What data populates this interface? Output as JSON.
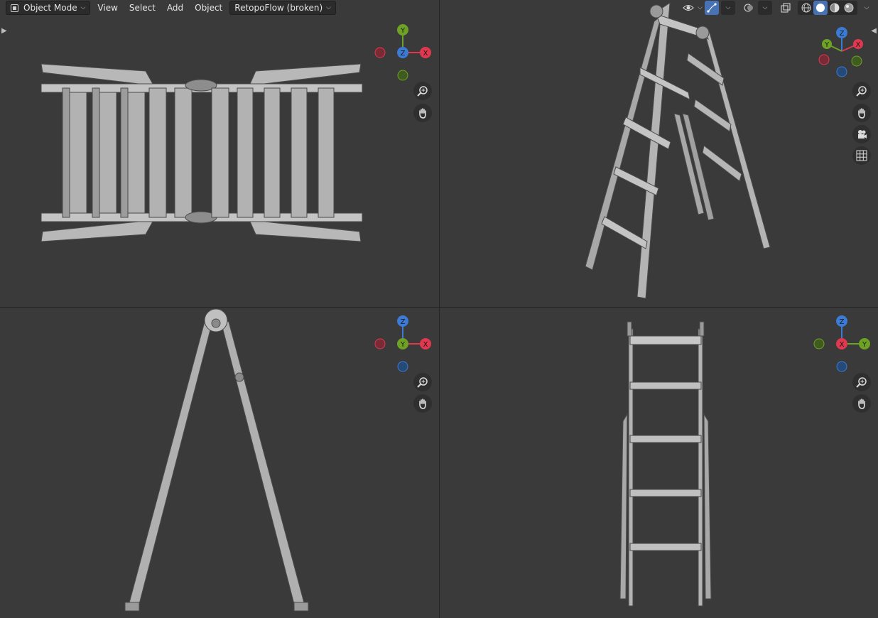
{
  "header": {
    "mode_label": "Object Mode",
    "menus": [
      "View",
      "Select",
      "Add",
      "Object"
    ],
    "addon_label": "RetopoFlow (broken)"
  },
  "viewports": {
    "top_left": {
      "view": "top",
      "gizmo_axes": [
        "Y",
        "Z",
        "X"
      ]
    },
    "top_right": {
      "view": "user-perspective",
      "gizmo_axes": [
        "Z",
        "Y",
        "X"
      ]
    },
    "bottom_left": {
      "view": "front",
      "gizmo_axes": [
        "Z",
        "Y",
        "X"
      ]
    },
    "bottom_right": {
      "view": "right",
      "gizmo_axes": [
        "Z",
        "X",
        "Y"
      ]
    }
  },
  "colors": {
    "background": "#393939",
    "axis_x": "#e0384f",
    "axis_y": "#6ea225",
    "axis_z": "#3b7bd6",
    "selected": "#4772b3",
    "mesh": "#a9a9a9"
  },
  "icons": {
    "zoom": "zoom-icon",
    "pan": "hand-pan-icon",
    "camera": "camera-icon",
    "grid": "grid-icon"
  }
}
